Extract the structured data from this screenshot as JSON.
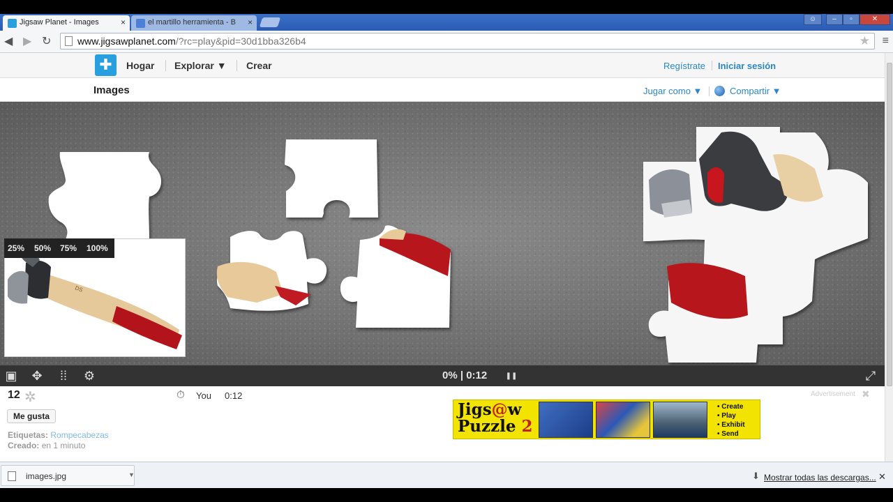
{
  "browser": {
    "tabs": [
      {
        "title": "Jigsaw Planet - Images",
        "close": "×"
      },
      {
        "title": "el martillo herramienta - B",
        "close": "×"
      }
    ],
    "url_host": "www.jigsawplanet.com",
    "url_rest": "/?rc=play&pid=30d1bba326b4",
    "nav_icons": [
      "back-icon",
      "forward-icon",
      "reload-icon"
    ]
  },
  "site": {
    "nav": {
      "home": "Hogar",
      "explore": "Explorar ▼",
      "create": "Crear",
      "register": "Regístrate",
      "login": "Iniciar sesión"
    },
    "page_title": "Images",
    "play_as": "Jugar como ▼",
    "share": "Compartir ▼"
  },
  "puzzle": {
    "zoom_options": [
      "25%",
      "50%",
      "75%",
      "100%"
    ],
    "progress": "0% | 0:12",
    "pause_icon": "❚❚",
    "piece_count": "12",
    "player": "You",
    "player_time": "0:12",
    "like_button": "Me gusta",
    "tags_label": "Etiquetas:",
    "tags_value": "Rompecabezas",
    "created_label": "Creado:",
    "created_value": "en 1 minuto"
  },
  "ad": {
    "label": "Advertisement",
    "brand_line1_a": "Jigs",
    "brand_at": "@",
    "brand_line1_b": "w",
    "brand_line2": "Puzzle ",
    "brand_two": "2",
    "features": [
      "Create",
      "Play",
      "Exhibit",
      "Send"
    ]
  },
  "downloads": {
    "file": "images.jpg",
    "show_all": "Mostrar todas las descargas..."
  },
  "colors": {
    "accent": "#2a86c8",
    "tabstrip": "#2b5cb5",
    "board": "#6f6f6f",
    "ad_yellow": "#f2e400"
  }
}
